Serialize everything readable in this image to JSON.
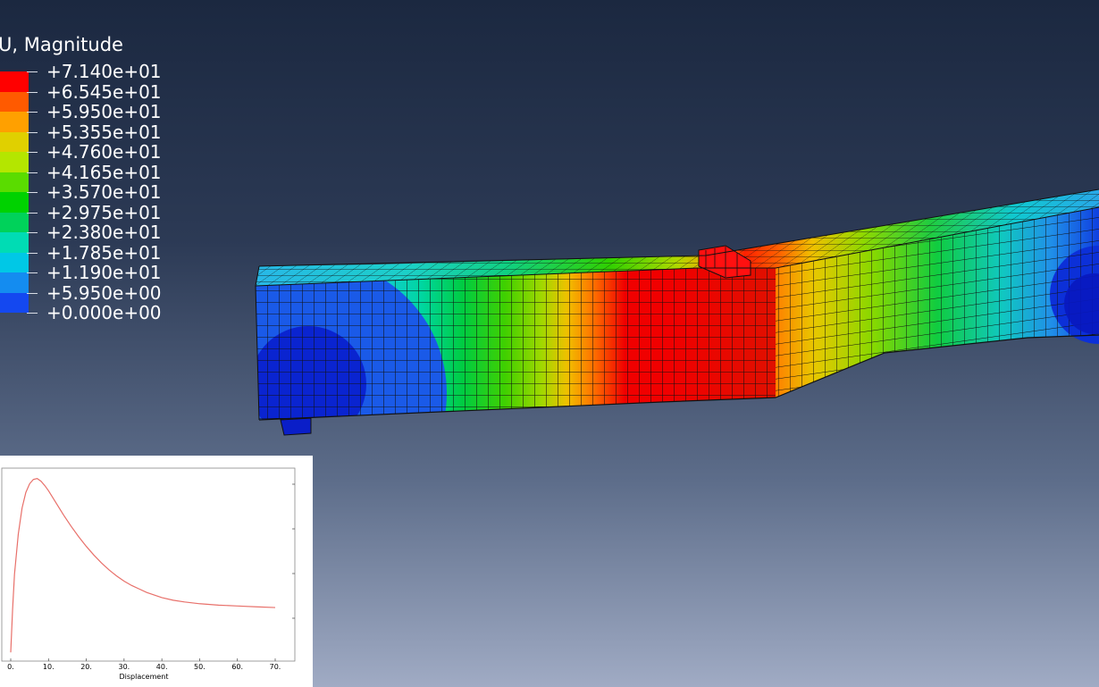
{
  "legend": {
    "title": "U, Magnitude",
    "labels": [
      "+7.140e+01",
      "+6.545e+01",
      "+5.950e+01",
      "+5.355e+01",
      "+4.760e+01",
      "+4.165e+01",
      "+3.570e+01",
      "+2.975e+01",
      "+2.380e+01",
      "+1.785e+01",
      "+1.190e+01",
      "+5.950e+00",
      "+0.000e+00"
    ],
    "colors": [
      "#ff0000",
      "#ff5a00",
      "#ffa000",
      "#e0d000",
      "#b4e600",
      "#5adc00",
      "#00d200",
      "#00d25a",
      "#00dcb4",
      "#00c8e6",
      "#148cf0",
      "#1448f0",
      "#0000f0"
    ]
  },
  "model": {
    "name": "deformed-beam-mesh"
  },
  "chart_data": {
    "type": "line",
    "title": "",
    "xlabel": "Displacement",
    "ylabel": "",
    "xlim": [
      0,
      70
    ],
    "x_ticks": [
      "0.",
      "10.",
      "20.",
      "30.",
      "40.",
      "50.",
      "60.",
      "70."
    ],
    "line_color": "#e8706a",
    "series": [
      {
        "x": [
          0,
          0.5,
          1,
          2,
          3,
          4,
          5,
          6,
          7,
          8,
          9,
          10,
          12,
          14,
          16,
          18,
          20,
          22,
          24,
          26,
          28,
          30,
          32,
          34,
          36,
          38,
          40,
          43,
          46,
          50,
          55,
          60,
          65,
          70
        ],
        "y": [
          0,
          25,
          45,
          68,
          83,
          92,
          97,
          99.5,
          100,
          98.5,
          96,
          93,
          86,
          79,
          72.5,
          66.5,
          61,
          56,
          51.5,
          47.5,
          44,
          41,
          38.5,
          36.5,
          34.5,
          33,
          31.5,
          30,
          29,
          28,
          27.2,
          26.7,
          26.2,
          25.8
        ]
      }
    ],
    "ylim": [
      -5,
      106
    ]
  }
}
